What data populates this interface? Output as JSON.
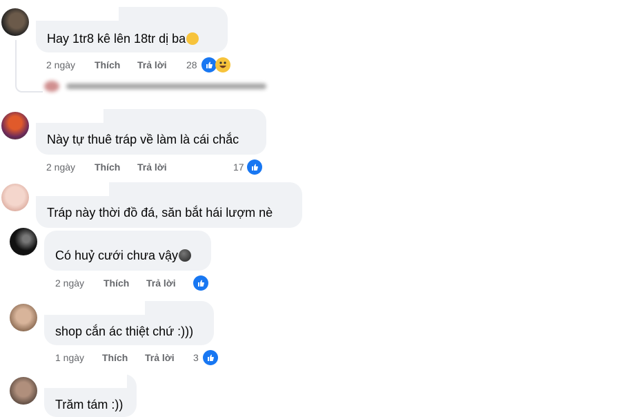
{
  "colors": {
    "bubble_bg": "#f0f2f5",
    "meta_text": "#65676b",
    "like_blue": "#1877f2",
    "haha_yellow": "#f7c33b"
  },
  "comments": [
    {
      "text": "Hay 1tr8 kê lên 18tr dị ba",
      "emoji": "haha-emoji",
      "time": "2 ngày",
      "like": "Thích",
      "reply": "Trả lời",
      "reactions": "28",
      "reaction_icons": [
        "like-icon",
        "haha-icon"
      ]
    },
    {
      "text": "Này tự thuê tráp về làm là cái chắc",
      "time": "2 ngày",
      "like": "Thích",
      "reply": "Trả lời",
      "reactions": "17",
      "reaction_icons": [
        "like-icon"
      ]
    },
    {
      "text": "Tráp này thời đồ đá, săn bắt hái lượm nè"
    },
    {
      "text": "Có huỷ cưới chưa vậy",
      "emoji": "dark-face-emoji",
      "time": "2 ngày",
      "like": "Thích",
      "reply": "Trả lời",
      "reactions": "",
      "reaction_icons": [
        "like-icon"
      ]
    },
    {
      "text": "shop cắn ác thiệt chứ :)))",
      "time": "1 ngày",
      "like": "Thích",
      "reply": "Trả lời",
      "reactions": "3",
      "reaction_icons": [
        "like-icon"
      ]
    },
    {
      "text": "Trăm tám :))"
    }
  ]
}
